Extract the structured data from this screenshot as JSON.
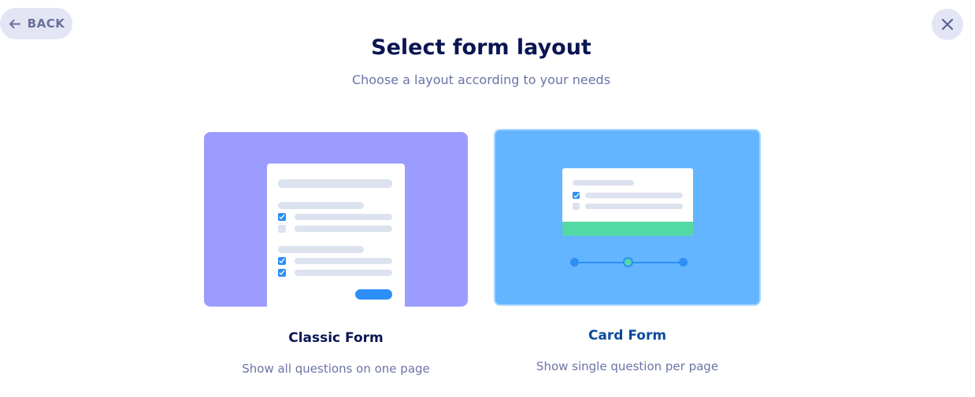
{
  "header": {
    "back_label": "BACK",
    "title": "Select form layout",
    "subtitle": "Choose a layout according to your needs"
  },
  "icons": {
    "back": "arrow-left-icon",
    "close": "close-icon"
  },
  "colors": {
    "title": "#0a1551",
    "muted": "#6c73a8",
    "button_bg": "#e3e5f5",
    "classic_bg": "#9c9cff",
    "card_bg": "#64b5ff",
    "accent_blue": "#2d8ef5",
    "accent_green": "#52d9a4"
  },
  "layouts": [
    {
      "label": "Classic Form",
      "description": "Show all questions on one page"
    },
    {
      "label": "Card Form",
      "description": "Show single question per page",
      "selected": true
    }
  ]
}
